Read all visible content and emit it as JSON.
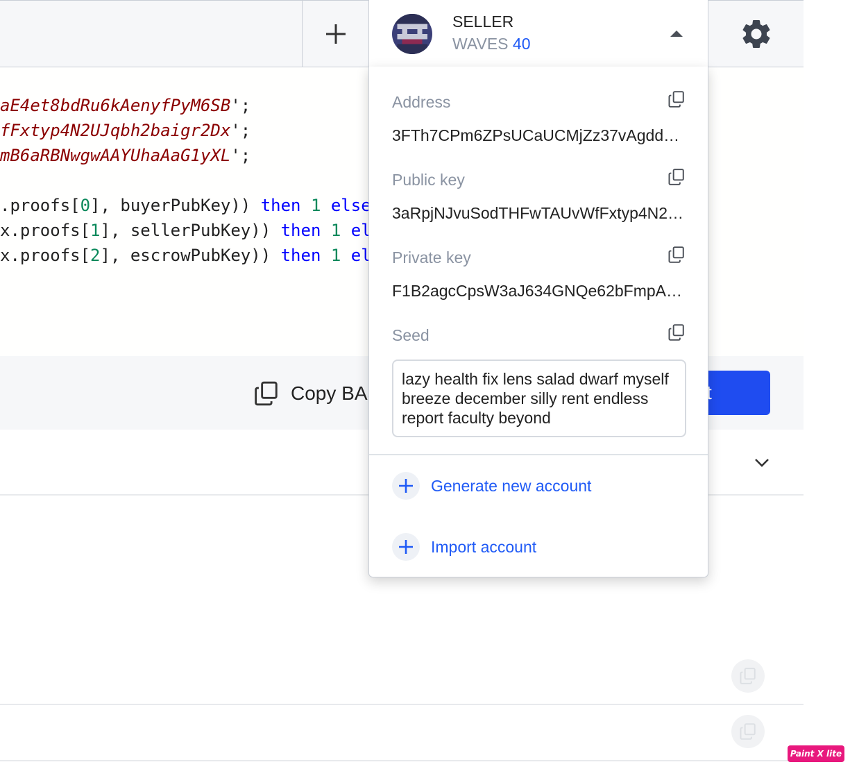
{
  "header": {
    "account_name": "SELLER",
    "balance_currency": "WAVES",
    "balance_amount": "40"
  },
  "icons": {
    "add": "plus-icon",
    "settings": "gear-icon",
    "expand": "caret-up-icon",
    "copy": "copy-icon",
    "chevron": "chevron-down-icon"
  },
  "editor": {
    "lines": [
      {
        "str": "aE4et8bdRu6kAenyfPyM6SB",
        "end": "';"
      },
      {
        "str": "fFxtyp4N2UJqbh2baigr2Dx",
        "end": "';"
      },
      {
        "str": "mB6aRBNwgwAAYUhaAaG1yXL",
        "end": "';"
      }
    ],
    "proofs": [
      {
        "pre": ".proofs[",
        "idx": "0",
        "mid": "], buyerPubKey)) ",
        "kw": "then",
        "one": "1",
        "tail": "else"
      },
      {
        "pre": "x.proofs[",
        "idx": "1",
        "mid": "], sellerPubKey)) ",
        "kw": "then",
        "one": "1",
        "tail": "el"
      },
      {
        "pre": "x.proofs[",
        "idx": "2",
        "mid": "], escrowPubKey)) ",
        "kw": "then",
        "one": "1",
        "tail": "el"
      }
    ]
  },
  "toolbar": {
    "copy_label": "Copy BAS",
    "primary_label": "t"
  },
  "dropdown": {
    "address_label": "Address",
    "address_value": "3FTh7CPm6ZPsUCaUCMjZz37vAgdd…",
    "pubkey_label": "Public key",
    "pubkey_value": "3aRpjNJvuSodTHFwTAUvWfFxtyp4N2…",
    "privkey_label": "Private key",
    "privkey_value": "F1B2agcCpsW3aJ634GNQe62bFmpA…",
    "seed_label": "Seed",
    "seed_value": "lazy health fix lens salad dwarf myself breeze december silly rent endless report faculty beyond",
    "generate_label": "Generate new account",
    "import_label": "Import account"
  },
  "watermark": "Paint X lite"
}
